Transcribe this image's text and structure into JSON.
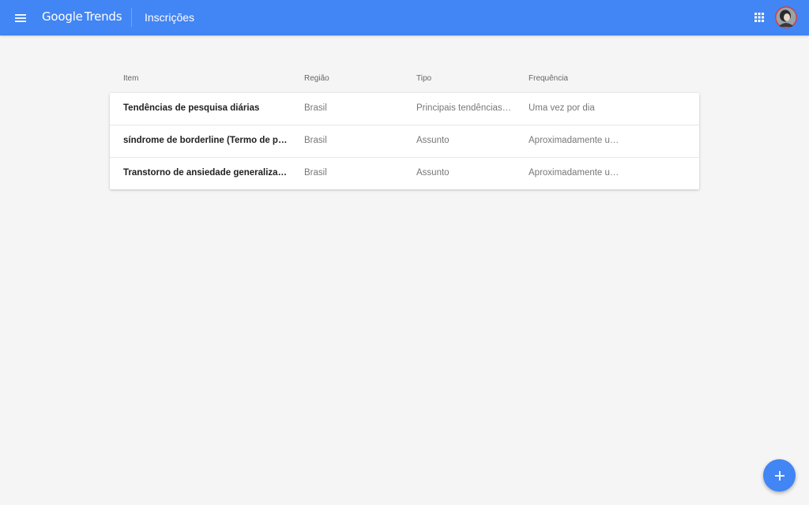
{
  "header": {
    "logo_google": "Google",
    "logo_product": "Trends",
    "title": "Inscrições",
    "menu_icon": "menu-icon",
    "apps_icon": "apps-grid-icon",
    "accent_color": "#4285f4"
  },
  "table": {
    "columns": {
      "item": "Item",
      "region": "Região",
      "type": "Tipo",
      "frequency": "Frequência"
    },
    "rows": [
      {
        "item": "Tendências de pesquisa diárias",
        "region": "Brasil",
        "type": "Principais tendências …",
        "frequency": "Uma vez por dia"
      },
      {
        "item": "síndrome de borderline (Termo de pesq…",
        "region": "Brasil",
        "type": "Assunto",
        "frequency": "Aproximadamente um…"
      },
      {
        "item": "Transtorno de ansiedade generalizada (…",
        "region": "Brasil",
        "type": "Assunto",
        "frequency": "Aproximadamente um…"
      }
    ]
  },
  "fab": {
    "icon": "add-icon"
  }
}
